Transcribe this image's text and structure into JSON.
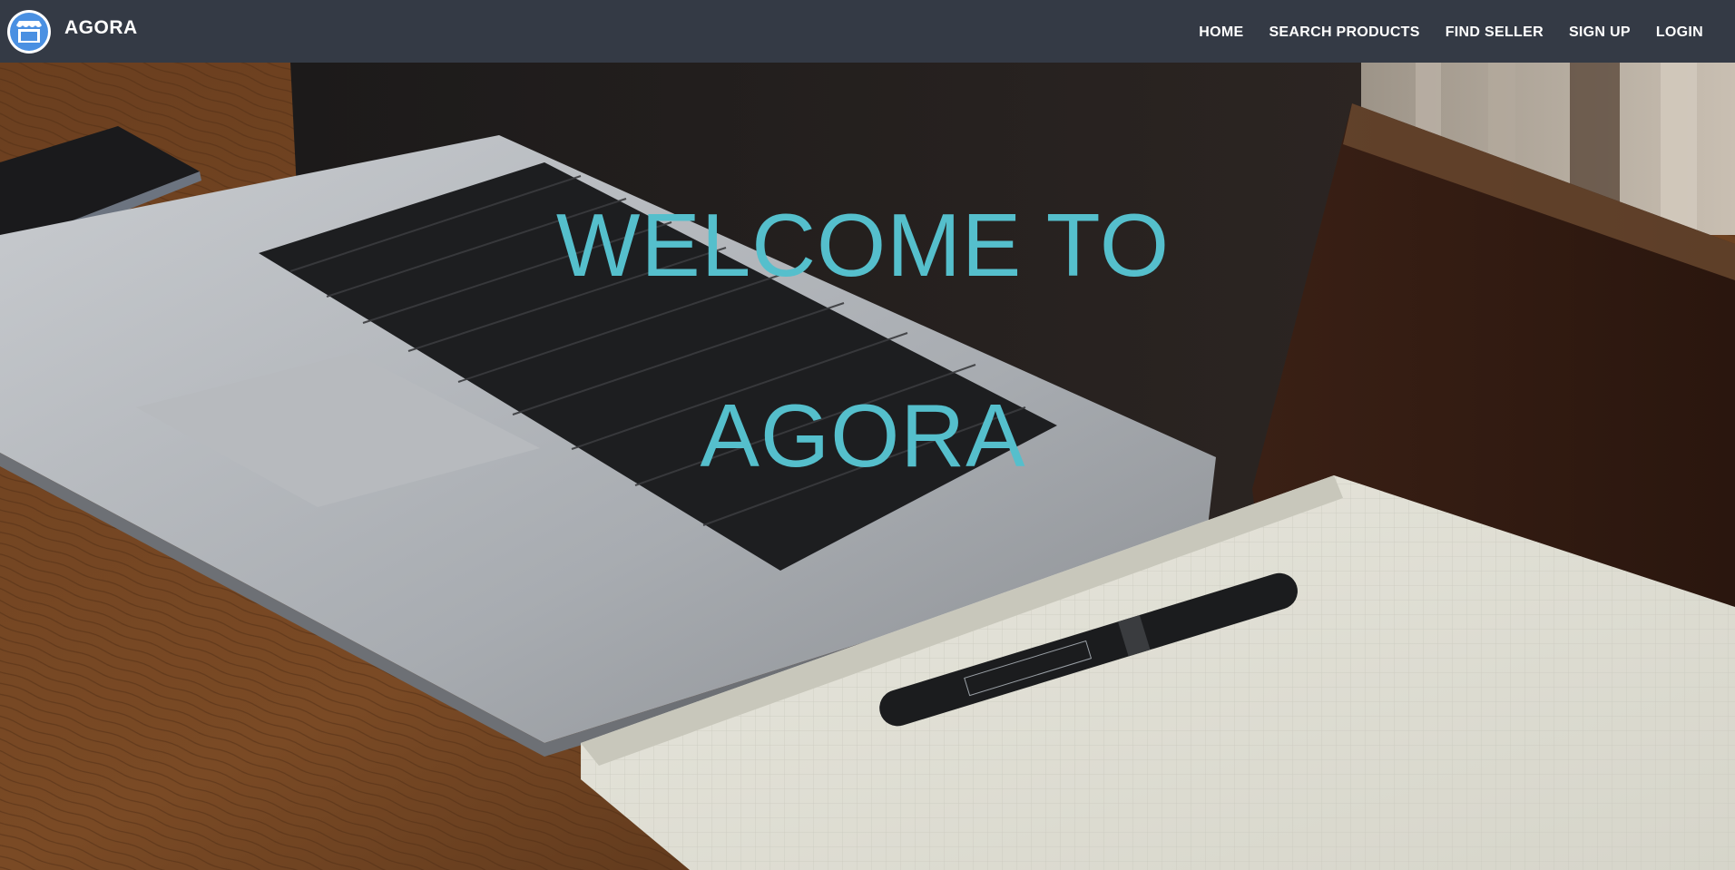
{
  "brand": {
    "name": "AGORA",
    "logo_icon": "storefront-icon"
  },
  "nav": {
    "items": [
      {
        "label": "HOME"
      },
      {
        "label": "SEARCH PRODUCTS"
      },
      {
        "label": "FIND SELLER"
      },
      {
        "label": "SIGN UP"
      },
      {
        "label": "LOGIN"
      }
    ]
  },
  "hero": {
    "line1": "WELCOME TO",
    "line2": "AGORA",
    "background_image": "laptop-notebook-pen-desk-photo"
  },
  "colors": {
    "navbar_bg": "#343a45",
    "hero_text": "#55bfcc",
    "logo_blue": "#4a90e2"
  }
}
